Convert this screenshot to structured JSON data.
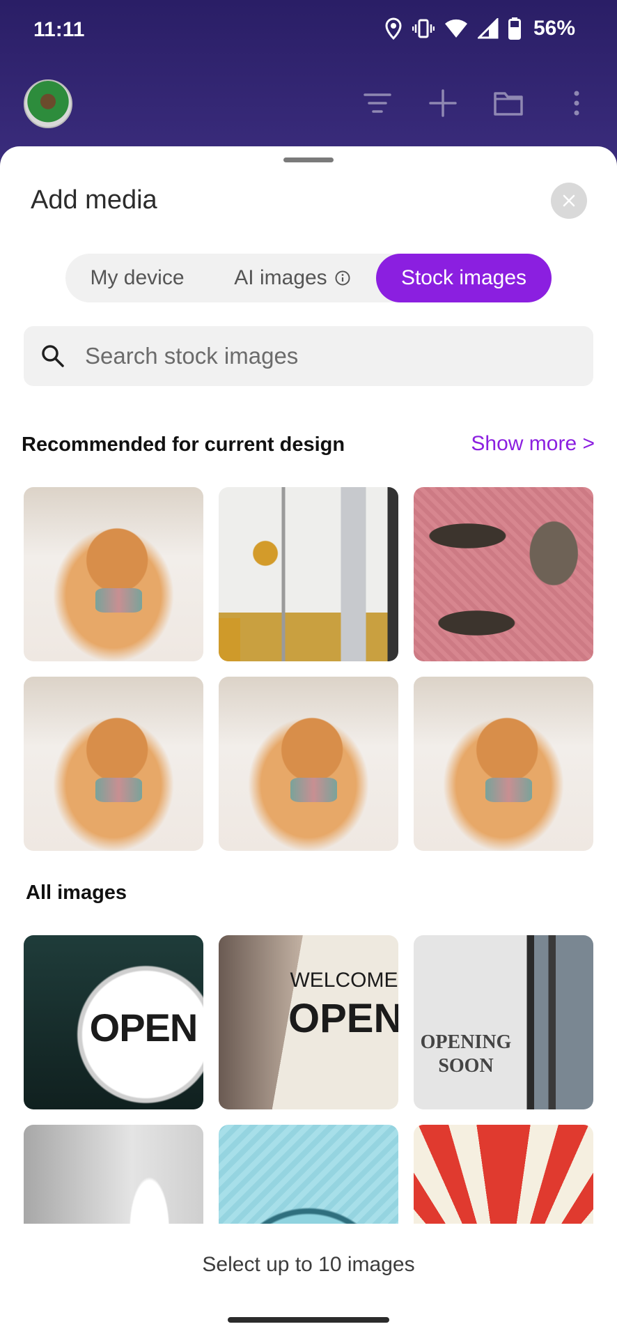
{
  "status_bar": {
    "time": "11:11",
    "battery": "56%"
  },
  "sheet": {
    "title": "Add media"
  },
  "tabs": [
    {
      "label": "My device",
      "active": false
    },
    {
      "label": "AI images",
      "active": false
    },
    {
      "label": "Stock images",
      "active": true
    }
  ],
  "search": {
    "placeholder": "Search stock images",
    "value": ""
  },
  "recommended": {
    "title": "Recommended for current design",
    "show_more": "Show more >",
    "images": [
      "cat-with-bowtie",
      "abstract-art",
      "tabby-cat-sleeping",
      "cat-with-bowtie",
      "cat-with-bowtie",
      "cat-with-bowtie"
    ]
  },
  "all_images": {
    "title": "All images",
    "images": [
      "open-sign",
      "welcome-open-sign",
      "opening-soon-sign",
      "open-door",
      "blue-target",
      "red-umbrella"
    ],
    "sign_text": {
      "open": "OPEN",
      "welcome": "WELCOME",
      "opening": "OPENING",
      "soon": "SOON"
    }
  },
  "footer": {
    "text": "Select up to 10 images"
  },
  "colors": {
    "accent": "#8b1fe0",
    "header": "#2a1e66"
  }
}
